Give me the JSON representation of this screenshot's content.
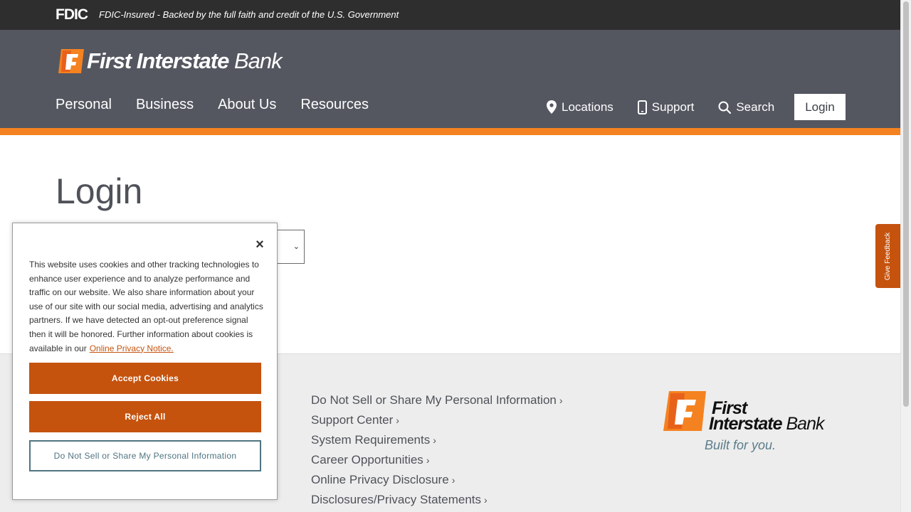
{
  "fdic": {
    "logo": "FDIC",
    "notice": "FDIC-Insured - Backed by the full faith and credit of the U.S. Government"
  },
  "brand": {
    "name_bold": "First Interstate",
    "name_light": " Bank"
  },
  "main_nav": [
    {
      "label": "Personal"
    },
    {
      "label": "Business"
    },
    {
      "label": "About Us"
    },
    {
      "label": "Resources"
    }
  ],
  "util_nav": {
    "locations": "Locations",
    "support": "Support",
    "search": "Search",
    "login": "Login"
  },
  "page": {
    "title": "Login"
  },
  "feedback": {
    "label": "Give Feedback"
  },
  "footer": {
    "links": [
      "Do Not Sell or Share My Personal Information",
      "Support Center",
      "System Requirements",
      "Career Opportunities",
      "Online Privacy Disclosure",
      "Disclosures/Privacy Statements"
    ],
    "brand_line1": "First",
    "brand_line2_bold": "Interstate",
    "brand_line2_light": " Bank",
    "tagline": "Built for you."
  },
  "cookie": {
    "close": "×",
    "text": "This website uses cookies and other tracking technologies to enhance user experience and to analyze performance and traffic on our website. We also share information about your use of our site with our social media, advertising and analytics partners. If we have detected an opt-out preference signal then it will be honored. Further information about cookies is available in our",
    "link": "Online Privacy Notice.",
    "accept": "Accept Cookies",
    "reject": "Reject All",
    "do_not_sell": "Do Not Sell or Share My Personal Information"
  },
  "colors": {
    "header": "#545760",
    "accent": "#f58220",
    "button": "#c5530e",
    "outline": "#4f7480"
  }
}
